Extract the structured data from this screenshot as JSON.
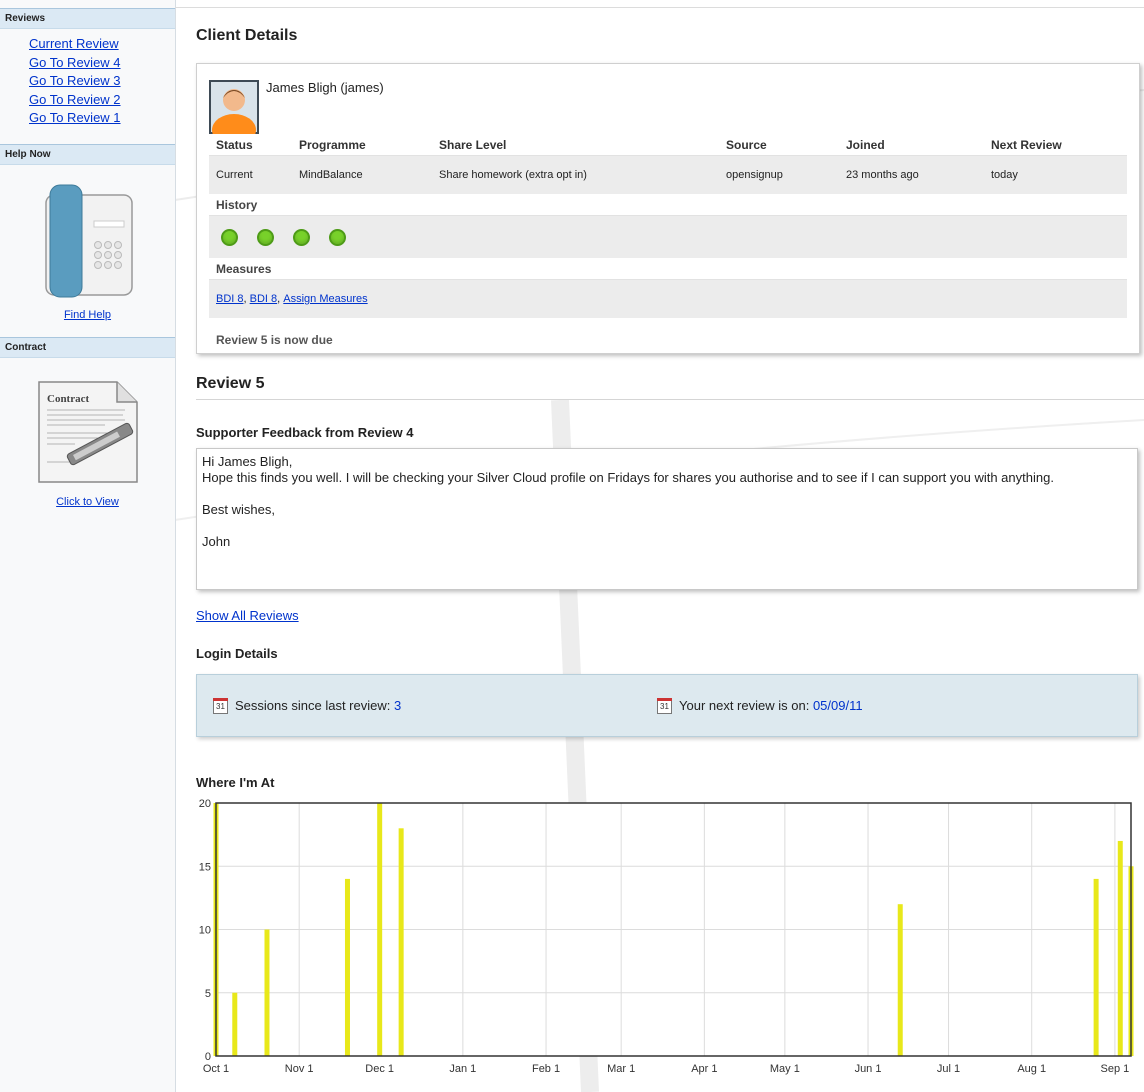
{
  "sidebar": {
    "reviews_header": "Reviews",
    "review_links": [
      "Current Review",
      "Go To Review 4",
      "Go To Review 3",
      "Go To Review 2",
      "Go To Review 1"
    ],
    "help_header": "Help Now",
    "help_link": "Find Help",
    "contract_header": "Contract",
    "contract_doc_title": "Contract",
    "contract_link": "Click to View"
  },
  "client": {
    "section_title": "Client Details",
    "name": "James Bligh (james)",
    "columns": [
      "Status",
      "Programme",
      "Share Level",
      "Source",
      "Joined",
      "Next Review"
    ],
    "row": [
      "Current",
      "MindBalance",
      "Share homework (extra opt in)",
      "opensignup",
      "23 months ago",
      "today"
    ],
    "history_label": "History",
    "history_count": 4,
    "measures_label": "Measures",
    "measures_links": [
      "BDI 8",
      "BDI 8",
      "Assign Measures"
    ],
    "due_text": "Review 5 is now due"
  },
  "review": {
    "title": "Review 5",
    "feedback_title": "Supporter Feedback from Review 4",
    "feedback_lines": [
      "Hi James Bligh,",
      "Hope this finds you well. I will be checking your Silver Cloud profile on Fridays for shares you authorise and to see if I can support you with anything.",
      "",
      "Best wishes,",
      "",
      "John"
    ],
    "show_all_link": "Show All Reviews"
  },
  "login": {
    "title": "Login Details",
    "sessions_label": "Sessions since last review:",
    "sessions_value": "3",
    "next_label": "Your next review is on:",
    "next_value": "05/09/11",
    "calendar_day": "31"
  },
  "chart_title": "Where I'm At",
  "chart_data": {
    "type": "bar",
    "ylim": [
      0,
      20
    ],
    "yticks": [
      0,
      5,
      10,
      15,
      20
    ],
    "xticks": [
      "Oct 1",
      "Nov 1",
      "Dec 1",
      "Jan 1",
      "Feb 1",
      "Mar 1",
      "Apr 1",
      "May 1",
      "Jun 1",
      "Jul 1",
      "Aug 1",
      "Sep 1"
    ],
    "x_range": [
      "2010-10-01",
      "2011-09-07"
    ],
    "bars": [
      {
        "date": "2010-10-01",
        "value": 20
      },
      {
        "date": "2010-10-08",
        "value": 5
      },
      {
        "date": "2010-10-20",
        "value": 10
      },
      {
        "date": "2010-11-19",
        "value": 14
      },
      {
        "date": "2010-12-01",
        "value": 20
      },
      {
        "date": "2010-12-09",
        "value": 18
      },
      {
        "date": "2011-06-13",
        "value": 12
      },
      {
        "date": "2011-08-25",
        "value": 14
      },
      {
        "date": "2011-09-03",
        "value": 17
      },
      {
        "date": "2011-09-07",
        "value": 15
      }
    ],
    "bar_color": "#e8e81a",
    "grid": true
  }
}
